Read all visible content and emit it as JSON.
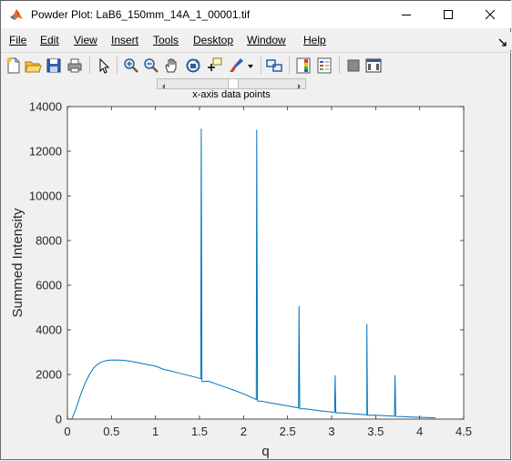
{
  "window": {
    "title": "Powder Plot: LaB6_150mm_14A_1_00001.tif"
  },
  "menubar": {
    "items": [
      {
        "label": "File",
        "underline": "F"
      },
      {
        "label": "Edit",
        "underline": "E"
      },
      {
        "label": "View",
        "underline": "V"
      },
      {
        "label": "Insert",
        "underline": "I"
      },
      {
        "label": "Tools",
        "underline": "T"
      },
      {
        "label": "Desktop",
        "underline": "D"
      },
      {
        "label": "Window",
        "underline": "W"
      },
      {
        "label": "Help",
        "underline": "H"
      }
    ]
  },
  "toolbar": {
    "icons": [
      "new-figure-icon",
      "open-file-icon",
      "save-icon",
      "print-icon",
      "edit-plot-arrow-icon",
      "zoom-in-icon",
      "zoom-out-icon",
      "pan-hand-icon",
      "rotate-3d-icon",
      "data-cursor-icon",
      "brush-icon",
      "brush-dropdown-icon",
      "link-plot-icon",
      "insert-colorbar-icon",
      "insert-legend-icon",
      "hide-plot-tools-icon",
      "show-plot-tools-icon"
    ]
  },
  "slider": {
    "label": "x-axis data points",
    "position": 0.5
  },
  "colors": {
    "line": "#0072bd",
    "axes": "#262626",
    "background": "#f0f0f0",
    "plot_background": "#ffffff"
  },
  "chart_data": {
    "type": "line",
    "title": "",
    "xlabel": "q",
    "ylabel": "Summed Intensity",
    "xlim": [
      0,
      4.5
    ],
    "ylim": [
      0,
      14000
    ],
    "xticks": [
      "0",
      "0.5",
      "1",
      "1.5",
      "2",
      "2.5",
      "3",
      "3.5",
      "4",
      "4.5"
    ],
    "yticks": [
      "0",
      "2000",
      "4000",
      "6000",
      "8000",
      "10000",
      "12000",
      "14000"
    ],
    "grid": false,
    "background_curve": [
      [
        0.05,
        0
      ],
      [
        0.1,
        500
      ],
      [
        0.15,
        1100
      ],
      [
        0.2,
        1600
      ],
      [
        0.25,
        2000
      ],
      [
        0.3,
        2300
      ],
      [
        0.35,
        2480
      ],
      [
        0.4,
        2580
      ],
      [
        0.45,
        2630
      ],
      [
        0.5,
        2650
      ],
      [
        0.6,
        2640
      ],
      [
        0.7,
        2600
      ],
      [
        0.8,
        2530
      ],
      [
        0.9,
        2450
      ],
      [
        1.0,
        2370
      ],
      [
        1.1,
        2220
      ],
      [
        1.2,
        2130
      ],
      [
        1.3,
        2030
      ],
      [
        1.4,
        1930
      ],
      [
        1.5,
        1830
      ],
      [
        1.6,
        1700
      ],
      [
        1.7,
        1560
      ],
      [
        1.8,
        1420
      ],
      [
        1.9,
        1280
      ],
      [
        2.0,
        1130
      ],
      [
        2.1,
        950
      ],
      [
        2.2,
        800
      ],
      [
        2.3,
        730
      ],
      [
        2.4,
        660
      ],
      [
        2.5,
        590
      ],
      [
        2.6,
        520
      ],
      [
        2.7,
        460
      ],
      [
        2.8,
        410
      ],
      [
        2.9,
        360
      ],
      [
        3.0,
        320
      ],
      [
        3.1,
        280
      ],
      [
        3.2,
        250
      ],
      [
        3.3,
        220
      ],
      [
        3.4,
        190
      ],
      [
        3.5,
        170
      ],
      [
        3.6,
        150
      ],
      [
        3.7,
        130
      ],
      [
        3.8,
        110
      ],
      [
        3.9,
        95
      ],
      [
        4.0,
        80
      ],
      [
        4.1,
        65
      ],
      [
        4.18,
        50
      ]
    ],
    "peaks": [
      {
        "q": 1.52,
        "intensity": 13000
      },
      {
        "q": 2.15,
        "intensity": 12950
      },
      {
        "q": 2.63,
        "intensity": 5050
      },
      {
        "q": 3.04,
        "intensity": 1950
      },
      {
        "q": 3.4,
        "intensity": 4250
      },
      {
        "q": 3.72,
        "intensity": 1950
      }
    ]
  }
}
